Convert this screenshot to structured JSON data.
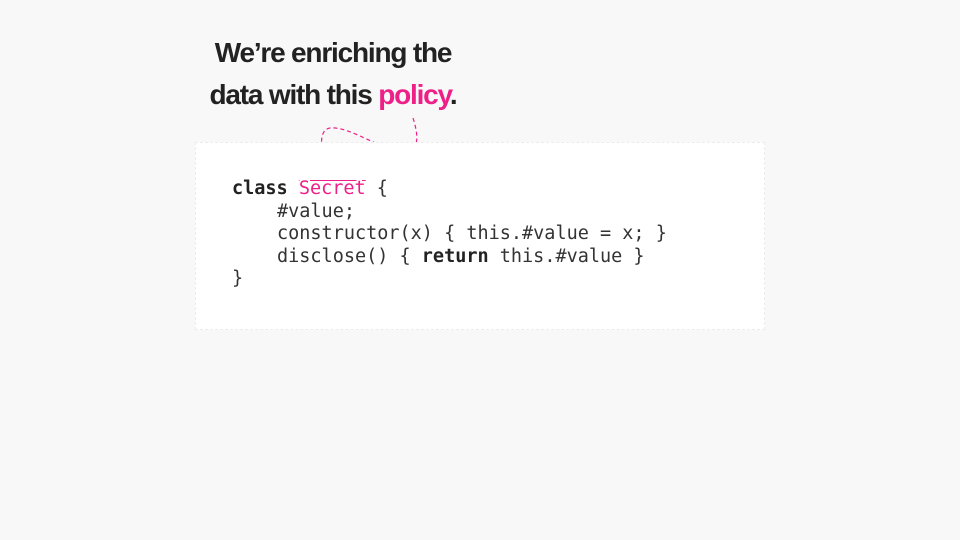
{
  "headline": {
    "line1": "We’re enriching the",
    "line2_prefix": "data with this ",
    "line2_accent": "policy",
    "line2_suffix": "."
  },
  "code": {
    "line1_kw": "class",
    "line1_class_name": "Secret",
    "line1_rest": " {",
    "line2": "#value;",
    "line3": "constructor(x) { this.#value = x; }",
    "line4_pre": "disclose() { ",
    "line4_kw": "return",
    "line4_post": " this.#value }",
    "line5": "}"
  },
  "colors": {
    "accent": "#ef1f88",
    "background": "#f8f8f8",
    "card": "#ffffff",
    "text": "#222222"
  }
}
